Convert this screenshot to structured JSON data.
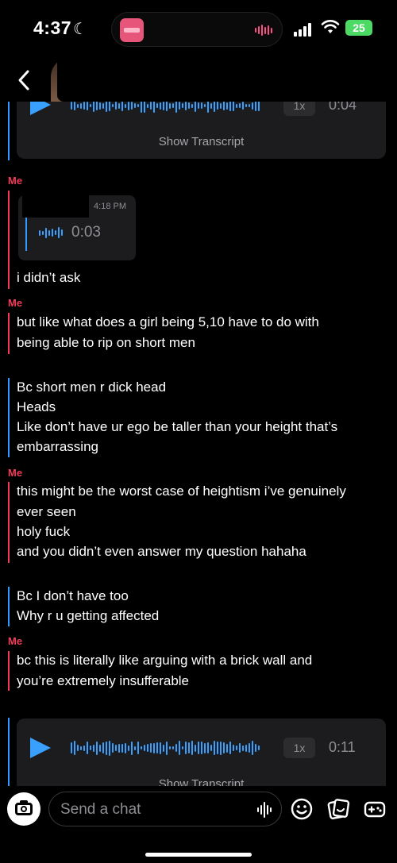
{
  "status_bar": {
    "time": "4:37",
    "battery": "25"
  },
  "header": {
    "back_icon": "chevron-left-icon",
    "contact_name_redacted": true
  },
  "voice_notes": [
    {
      "speed": "1x",
      "duration": "0:04",
      "transcript_label": "Show Transcript"
    },
    {
      "timestamp": "4:18 PM",
      "duration": "0:03"
    },
    {
      "speed": "1x",
      "duration": "0:11",
      "transcript_label": "Show Transcript"
    }
  ],
  "messages": {
    "me_label": "Me",
    "m1": [
      "i didn’t ask"
    ],
    "m2": [
      "but like what does a girl being 5,10 have to do with",
      "being able to rip on short men"
    ],
    "m3": [
      "Bc short men r dick head",
      "Heads",
      "Like don’t have ur ego be taller than your height that’s",
      "embarrassing"
    ],
    "m4": [
      "this might be the worst case of heightism i’ve genuinely",
      "ever seen",
      "holy fuck",
      "and you didn’t even answer my question hahaha"
    ],
    "m5": [
      "Bc I don’t have too",
      "Why r u getting affected"
    ],
    "m6": [
      "bc this is literally like arguing with a brick wall and",
      "you’re extremely insufferable"
    ]
  },
  "colors": {
    "me": "#f23c57",
    "them": "#2f9bff",
    "background": "#000000"
  },
  "composer": {
    "placeholder": "Send a chat",
    "icons": [
      "camera-icon",
      "microphone-icon",
      "emoji-icon",
      "stickers-icon",
      "games-icon"
    ]
  }
}
